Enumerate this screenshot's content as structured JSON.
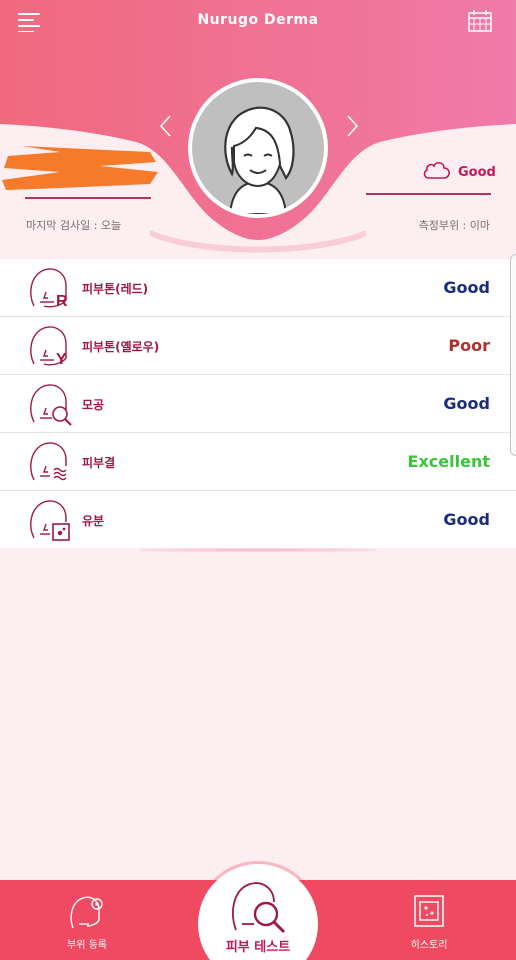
{
  "header": {
    "title": "Nurugo Derma",
    "weather_status": "Good",
    "last_check_label": "마지막 검사일 : 오늘",
    "measure_part_label": "측정부위 : 이마"
  },
  "colors": {
    "primary": "#f04a63",
    "good": "#1a2b80",
    "poor": "#b0302e",
    "excellent": "#3bc43b",
    "label": "#a01846"
  },
  "results": [
    {
      "label": "피부톤(레드)",
      "status": "Good",
      "icon": "face-r-icon"
    },
    {
      "label": "피부톤(옐로우)",
      "status": "Poor",
      "icon": "face-y-icon"
    },
    {
      "label": "모공",
      "status": "Good",
      "icon": "pore-magnifier-icon"
    },
    {
      "label": "피부결",
      "status": "Excellent",
      "icon": "skin-texture-icon"
    },
    {
      "label": "유분",
      "status": "Good",
      "icon": "sebum-icon"
    }
  ],
  "bottom_nav": {
    "left_label": "부위 등록",
    "center_label": "피부 테스트",
    "right_label": "히스토리"
  }
}
